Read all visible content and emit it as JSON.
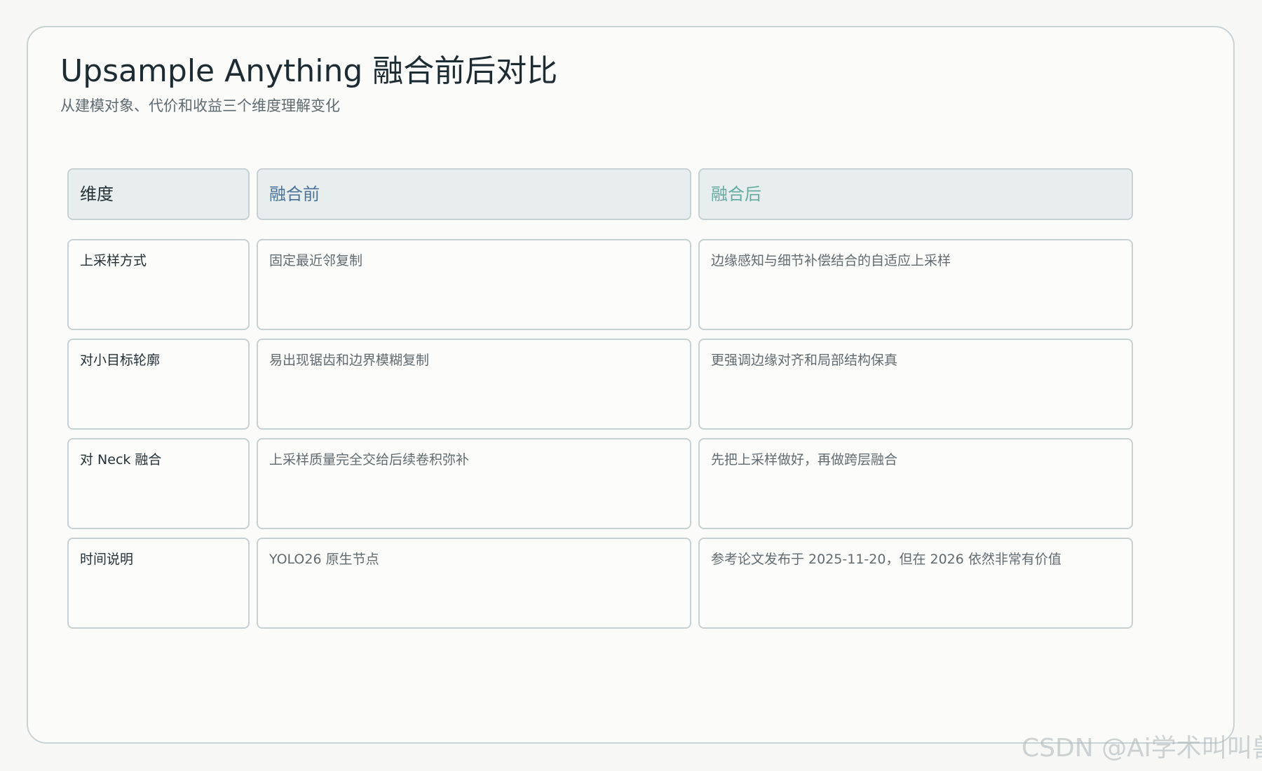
{
  "header": {
    "title": "Upsample Anything 融合前后对比",
    "subtitle": "从建模对象、代价和收益三个维度理解变化"
  },
  "colors": {
    "dimension_header": "#243137",
    "before_header": "#4b7298",
    "after_header": "#65aaa3",
    "border": "#c7d0d3",
    "header_fill": "#e8eeee"
  },
  "table": {
    "headers": [
      "维度",
      "融合前",
      "融合后"
    ],
    "rows": [
      {
        "dimension": "上采样方式",
        "before": "固定最近邻复制",
        "after": "边缘感知与细节补偿结合的自适应上采样"
      },
      {
        "dimension": "对小目标轮廓",
        "before": "易出现锯齿和边界模糊复制",
        "after": "更强调边缘对齐和局部结构保真"
      },
      {
        "dimension": "对 Neck 融合",
        "before": "上采样质量完全交给后续卷积弥补",
        "after": "先把上采样做好，再做跨层融合"
      },
      {
        "dimension": "时间说明",
        "before": "YOLO26 原生节点",
        "after": "参考论文发布于 2025-11-20，但在 2026 依然非常有价值"
      }
    ]
  },
  "watermark": "CSDN @Ai学术叫叫兽"
}
